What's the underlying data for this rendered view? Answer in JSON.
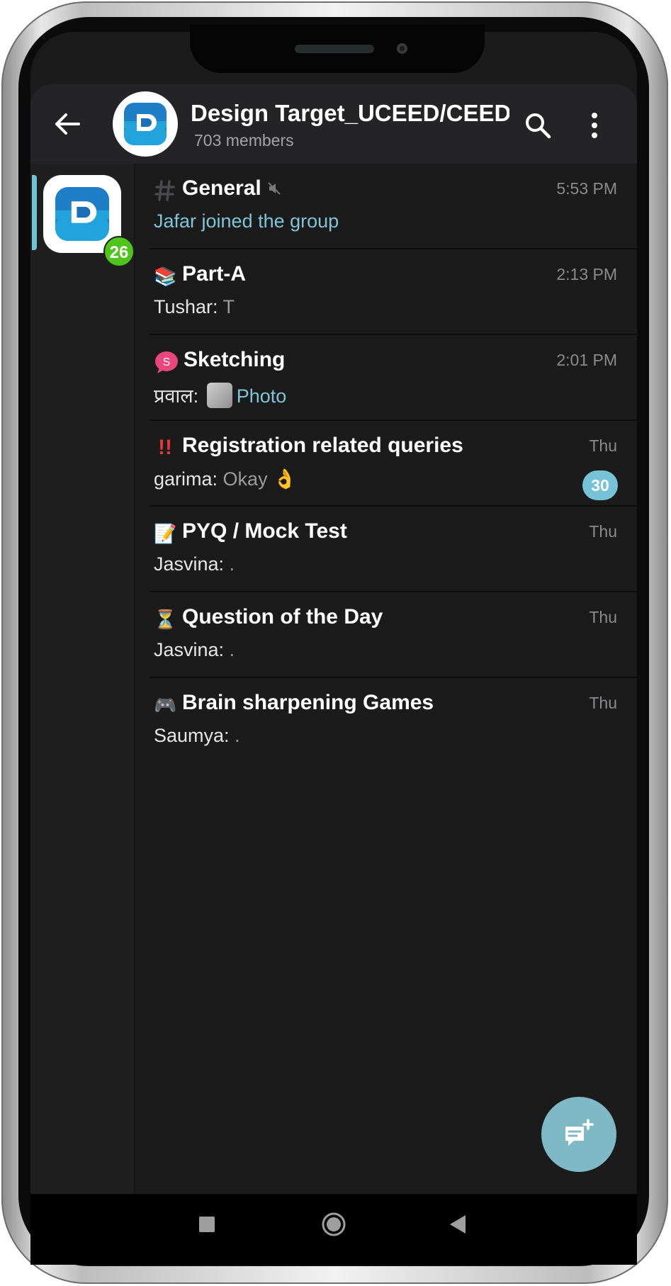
{
  "header": {
    "title": "Design Target_UCEED/CEED/",
    "subtitle": "703 members"
  },
  "rail": {
    "unread_count": "26"
  },
  "topics": [
    {
      "icon": "hash-icon",
      "name": "General",
      "muted": true,
      "time": "5:53 PM",
      "message_service": "Jafar joined the group"
    },
    {
      "icon": "books-emoji-icon",
      "emoji": "📚",
      "name": "Part-A",
      "time": "2:13 PM",
      "sender": "Tushar: ",
      "text": "T"
    },
    {
      "icon": "s-speech-bubble-icon",
      "name": "Sketching",
      "time": "2:01 PM",
      "sender": "प्रवाल: ",
      "media": "Photo"
    },
    {
      "icon": "double-exclamation-icon",
      "emoji": "‼️",
      "name": "Registration related queries",
      "time": "Thu",
      "sender": "garima: ",
      "text": "Okay 👌",
      "unread": "30"
    },
    {
      "icon": "memo-icon",
      "emoji": "📝",
      "name": "PYQ / Mock Test",
      "time": "Thu",
      "sender": "Jasvina: ",
      "text": "."
    },
    {
      "icon": "hourglass-icon",
      "emoji": "⏳",
      "name": "Question of the Day",
      "time": "Thu",
      "sender": "Jasvina: ",
      "text": "."
    },
    {
      "icon": "game-controller-icon",
      "emoji": "🎮",
      "name": "Brain sharpening Games",
      "time": "Thu",
      "sender": "Saumya: ",
      "text": "."
    }
  ],
  "colors": {
    "accent": "#76c3d7",
    "badge_green": "#4fc41a",
    "background": "#1b1b1b",
    "header": "#242426"
  }
}
